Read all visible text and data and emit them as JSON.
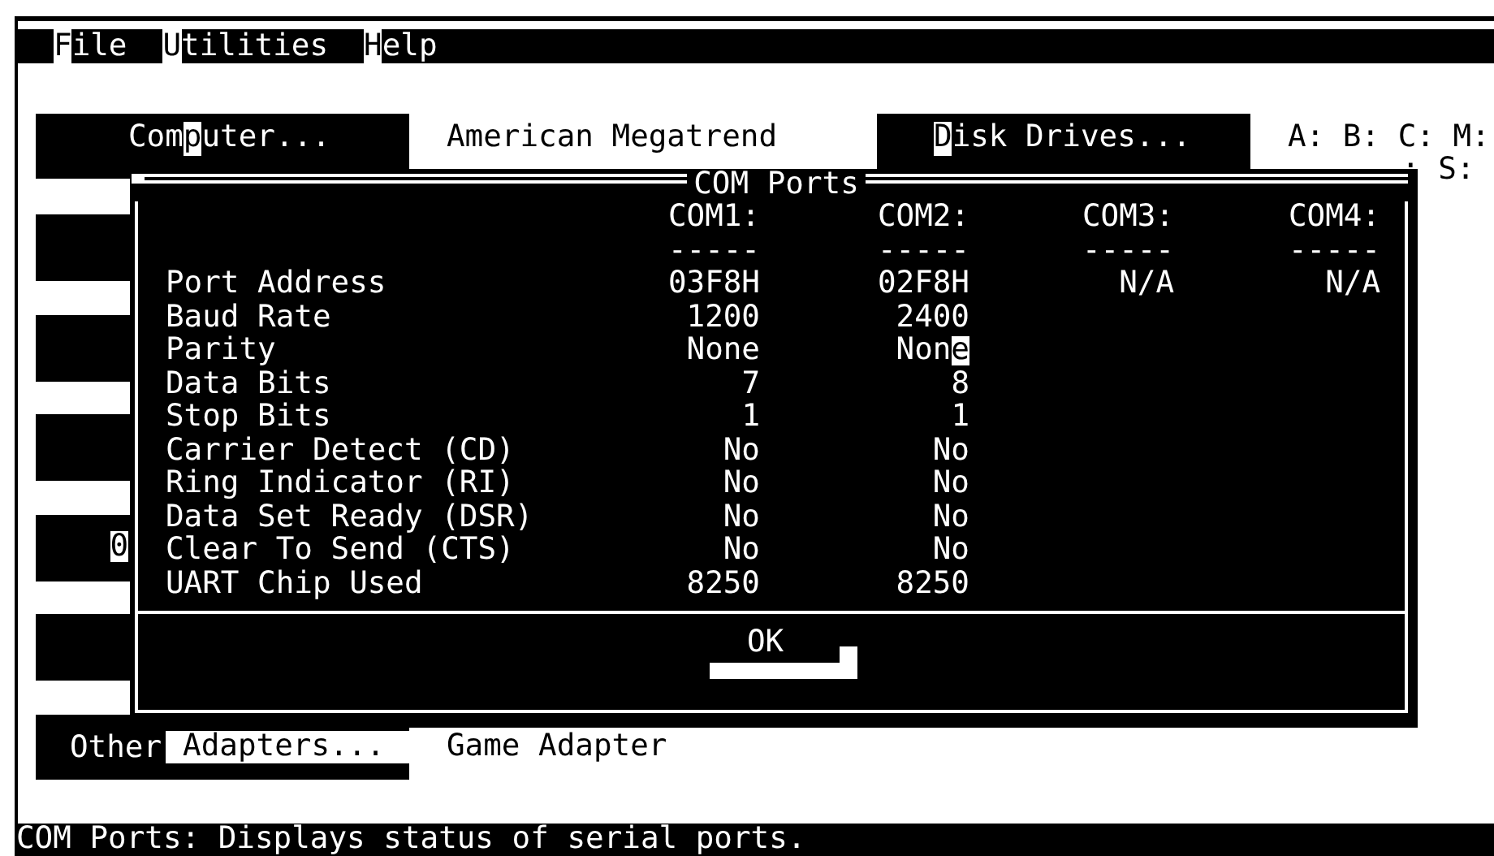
{
  "menu_bar": {
    "items": [
      {
        "hotkey": "F",
        "after": "ile"
      },
      {
        "hotkey": "U",
        "after": "tilities"
      },
      {
        "hotkey": "H",
        "after": "elp"
      }
    ]
  },
  "main": {
    "computer_button": {
      "before": "Com",
      "hotkey": "p",
      "after": "uter..."
    },
    "computer_value": "American Megatrend",
    "disk_drives_button": {
      "hotkey": "D",
      "after": "isk Drives..."
    },
    "disk_drives_value": [
      "A: B: C: M:",
      ": S:"
    ],
    "hidden_buttons": [
      {
        "kind": "blank"
      },
      {
        "kind": "blank"
      },
      {
        "kind": "blank"
      },
      {
        "kind": "label",
        "text": "0"
      },
      {
        "kind": "blank"
      }
    ],
    "other_adapters_button": {
      "before": "Other",
      "highlighted": "Adapters..."
    },
    "other_adapters_value": "Game Adapter"
  },
  "dialog": {
    "title": "COM Ports",
    "columns": [
      {
        "header": "COM1:",
        "rule": "-----"
      },
      {
        "header": "COM2:",
        "rule": "-----"
      },
      {
        "header": "COM3:",
        "rule": "-----"
      },
      {
        "header": "COM4:",
        "rule": "-----"
      }
    ],
    "rows": [
      {
        "label": "Port Address",
        "values": [
          {
            "text": "03F8H"
          },
          {
            "text": "02F8H"
          },
          {
            "text": "N/A"
          },
          {
            "text": "N/A"
          }
        ]
      },
      {
        "label": "Baud Rate",
        "values": [
          {
            "text": "1200"
          },
          {
            "text": "2400"
          }
        ]
      },
      {
        "label": "Parity",
        "values": [
          {
            "text": "None"
          },
          {
            "text": "None",
            "cursor": true
          }
        ]
      },
      {
        "label": "Data Bits",
        "values": [
          {
            "text": "7"
          },
          {
            "text": "8"
          }
        ]
      },
      {
        "label": "Stop Bits",
        "values": [
          {
            "text": "1"
          },
          {
            "text": "1"
          }
        ]
      },
      {
        "label": "Carrier Detect (CD)",
        "values": [
          {
            "text": "No"
          },
          {
            "text": "No"
          }
        ]
      },
      {
        "label": "Ring Indicator (RI)",
        "values": [
          {
            "text": "No"
          },
          {
            "text": "No"
          }
        ]
      },
      {
        "label": "Data Set Ready (DSR)",
        "values": [
          {
            "text": "No"
          },
          {
            "text": "No"
          }
        ]
      },
      {
        "label": "Clear To Send (CTS)",
        "values": [
          {
            "text": "No"
          },
          {
            "text": "No"
          }
        ]
      },
      {
        "label": "UART Chip Used",
        "values": [
          {
            "text": "8250"
          },
          {
            "text": "8250"
          }
        ]
      }
    ],
    "button": "OK"
  },
  "status_bar": "COM Ports: Displays status of serial ports."
}
